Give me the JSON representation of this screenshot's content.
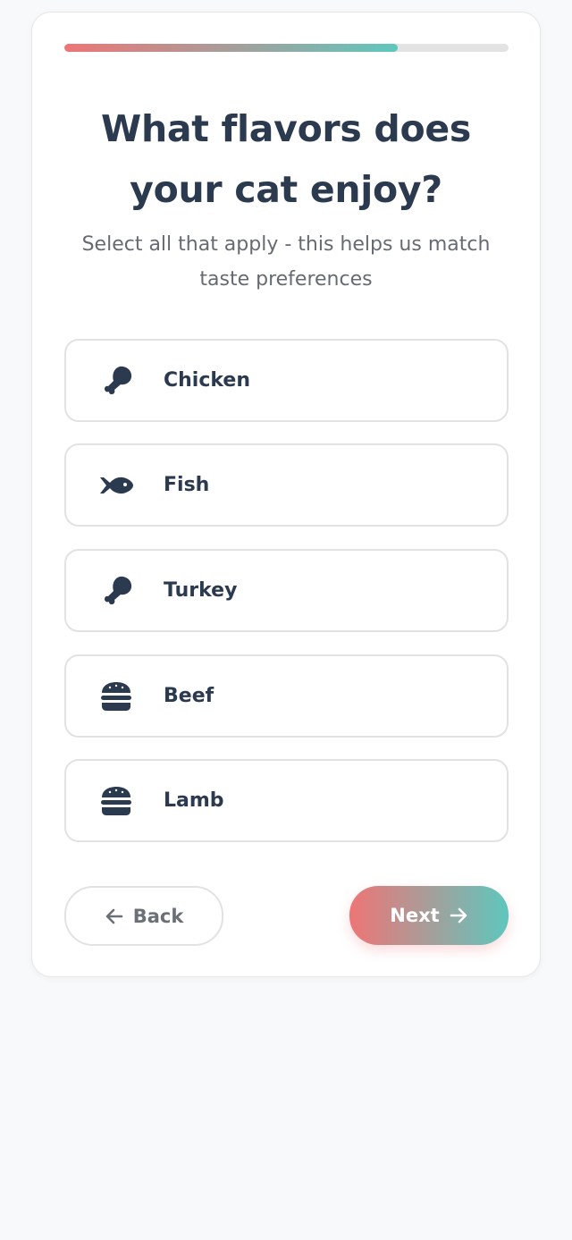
{
  "progress": {
    "value": 0.75
  },
  "question": {
    "title_line1": "What flavors does",
    "title_line2": "your cat enjoy?",
    "subtitle_line1": "Select all that apply - this helps us match",
    "subtitle_line2": "taste preferences"
  },
  "options": [
    {
      "label": "Chicken",
      "icon": "drumstick-icon"
    },
    {
      "label": "Fish",
      "icon": "fish-icon"
    },
    {
      "label": "Turkey",
      "icon": "drumstick-icon"
    },
    {
      "label": "Beef",
      "icon": "burger-icon"
    },
    {
      "label": "Lamb",
      "icon": "burger-icon"
    }
  ],
  "navigation": {
    "back_label": "Back",
    "next_label": "Next"
  },
  "colors": {
    "accent_start": "#ee7576",
    "accent_end": "#5ec7be",
    "text_dark": "#2b3a4f"
  }
}
